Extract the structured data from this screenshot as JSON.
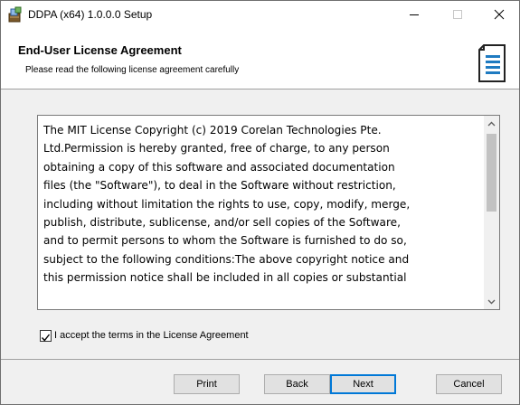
{
  "window": {
    "title": "DDPA (x64) 1.0.0.0 Setup"
  },
  "header": {
    "title": "End-User License Agreement",
    "subtitle": "Please read the following license agreement carefully"
  },
  "license": {
    "text": "The MIT License Copyright (c) 2019 Corelan Technologies Pte.\nLtd.Permission is hereby granted, free of charge, to any person\nobtaining a copy of this software and associated documentation\nfiles (the \"Software\"), to deal in the Software without restriction,\nincluding without limitation the rights to use, copy, modify, merge,\npublish, distribute, sublicense, and/or sell copies of the Software,\nand to permit persons to whom the Software is furnished to do so,\nsubject to the following conditions:The above copyright notice and\nthis permission notice shall be included in all copies or substantial"
  },
  "accept": {
    "label": "I accept the terms in the License Agreement",
    "checked": true
  },
  "buttons": {
    "print": "Print",
    "back": "Back",
    "next": "Next",
    "cancel": "Cancel"
  },
  "colors": {
    "accent": "#0078d7",
    "logo_blue": "#1f7bc1"
  }
}
